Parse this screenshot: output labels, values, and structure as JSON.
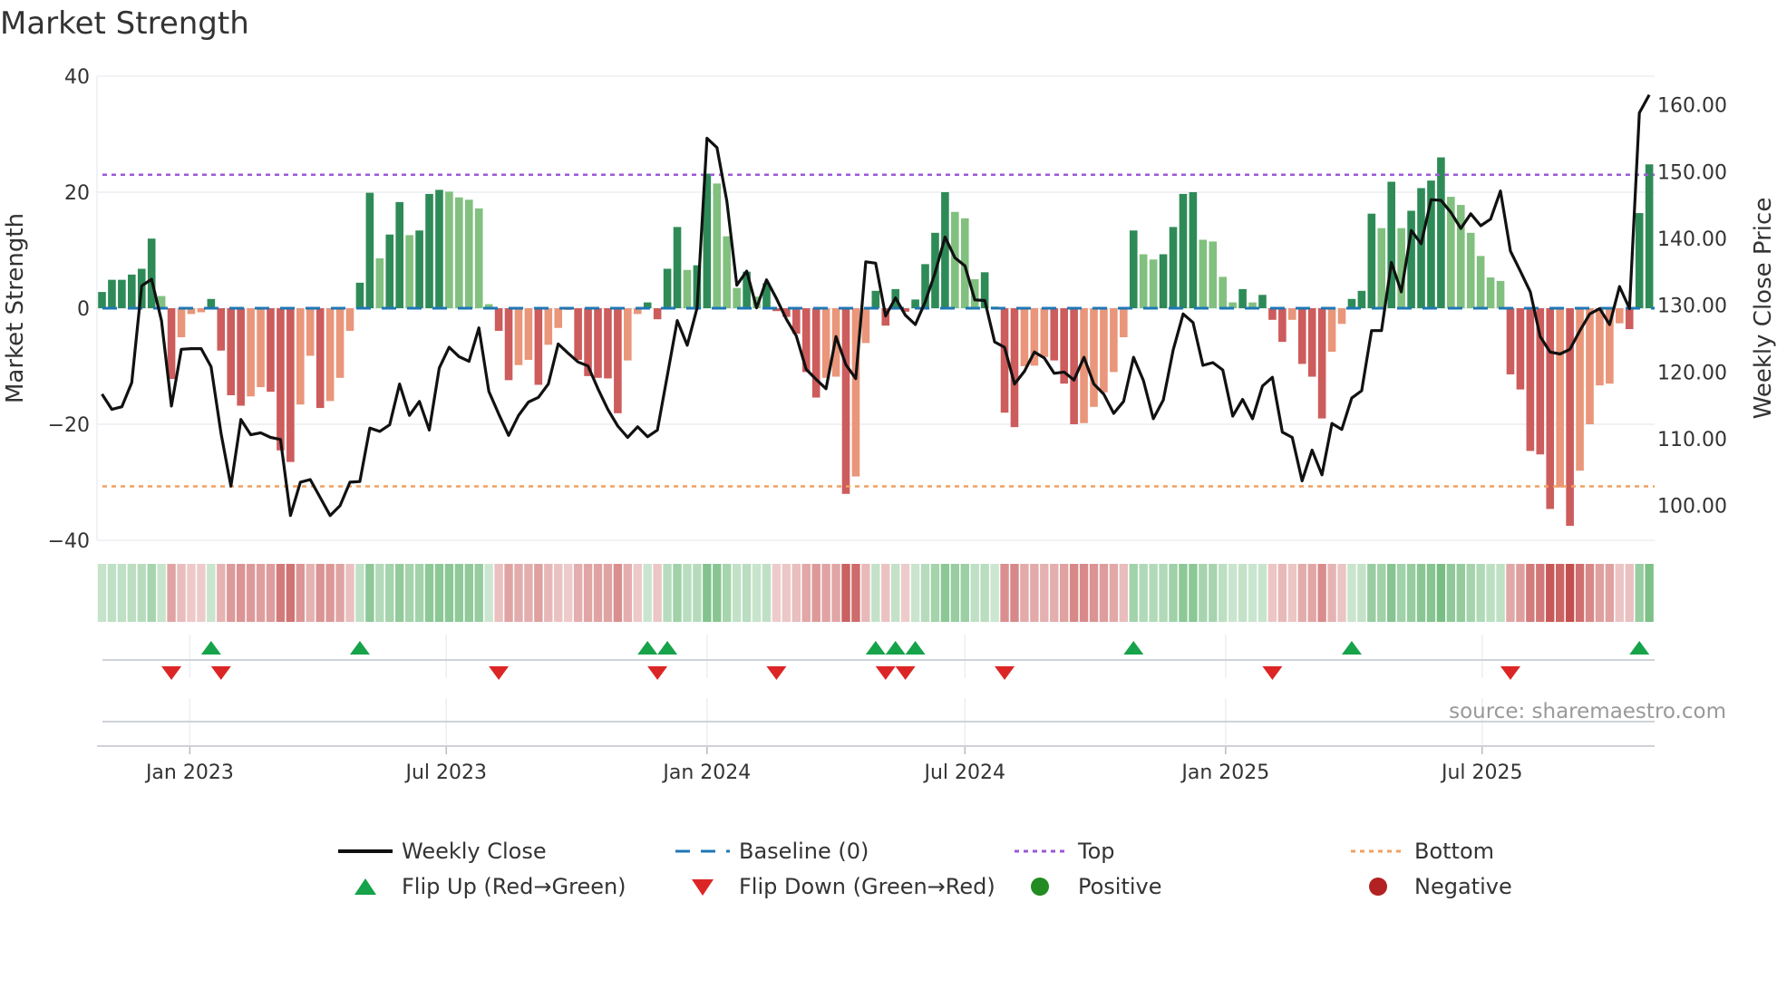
{
  "title": "Market Strength",
  "source": "source: sharemaestro.com",
  "legend": {
    "weekly_close": "Weekly Close",
    "baseline": "Baseline (0)",
    "top": "Top",
    "bottom": "Bottom",
    "flip_up": "Flip Up (Red→Green)",
    "flip_down": "Flip Down (Green→Red)",
    "positive": "Positive",
    "negative": "Negative"
  },
  "colors": {
    "strong_pos": "#2e8b57",
    "weak_pos": "#81c07f",
    "strong_neg": "#cd5c5c",
    "weak_neg": "#e9967a",
    "baseline": "#1f77b4",
    "top": "#9b59d6",
    "bottom": "#f0a060",
    "close": "#111111",
    "flip_up": "#16a34a",
    "flip_down": "#dc2626",
    "positive": "#228b22",
    "negative": "#b22222"
  },
  "chart_data": {
    "type": "bar",
    "title": "Market Strength",
    "xlabel": "",
    "ylabel": "Market Strength",
    "y2label": "Weekly Close Price",
    "ylim": [
      -40,
      40
    ],
    "y2lim": [
      94.8,
      164.3
    ],
    "yticks": [
      -40,
      -20,
      0,
      20,
      40
    ],
    "ytick_labels": [
      "−40",
      "−20",
      "0",
      "20",
      "40"
    ],
    "y2ticks": [
      100,
      110,
      120,
      130,
      140,
      150,
      160
    ],
    "y2tick_labels": [
      "100.00",
      "110.00",
      "120.00",
      "130.00",
      "140.00",
      "150.00",
      "160.00"
    ],
    "x_start": "2022-10-31",
    "x_step_days": 7,
    "xticks": [
      {
        "date": "2023-01-01",
        "label": "Jan 2023"
      },
      {
        "date": "2023-07-01",
        "label": "Jul 2023"
      },
      {
        "date": "2024-01-01",
        "label": "Jan 2024"
      },
      {
        "date": "2024-07-01",
        "label": "Jul 2024"
      },
      {
        "date": "2025-01-01",
        "label": "Jan 2025"
      },
      {
        "date": "2025-07-01",
        "label": "Jul 2025"
      }
    ],
    "top_level": 23.0,
    "bottom_level": -30.7,
    "grid": true,
    "legend_position": "bottom",
    "strength": [
      2.8,
      4.9,
      4.9,
      5.8,
      6.8,
      12,
      2.1,
      -12.2,
      -5,
      -1,
      -0.7,
      1.6,
      -7.3,
      -15,
      -16.8,
      -15.2,
      -13.6,
      -14.4,
      -24.5,
      -26.5,
      -16.6,
      -8.2,
      -17.2,
      -16,
      -12,
      -3.9,
      4.4,
      19.9,
      8.6,
      12.7,
      18.3,
      12.6,
      13.4,
      19.7,
      20.4,
      20.1,
      19.1,
      18.7,
      17.2,
      0.7,
      -3.9,
      -12.4,
      -9.8,
      -8.9,
      -13.2,
      -6.3,
      -3.4,
      -0.3,
      -8.9,
      -11.7,
      -12,
      -12.1,
      -18.1,
      -9,
      -1,
      1,
      -1.9,
      6.8,
      14,
      6.6,
      7.4,
      23.2,
      21.5,
      12.4,
      3.5,
      6.3,
      2,
      4.3,
      -0.5,
      -1.5,
      -4.4,
      -11,
      -15.4,
      -12,
      -11.8,
      -32,
      -29,
      -6,
      3,
      -3,
      3.3,
      -0.6,
      1.5,
      7.6,
      13,
      20,
      16.6,
      15.5,
      5,
      6.2,
      0.3,
      -18,
      -20.5,
      -10,
      -9.9,
      -8.4,
      -9,
      -13,
      -20,
      -19.8,
      -17,
      -14.5,
      -11,
      -5,
      13.4,
      9.3,
      8.4,
      9.3,
      14,
      19.7,
      20,
      11.8,
      11.5,
      5.4,
      1,
      3.3,
      1,
      2.3,
      -2,
      -5.8,
      -2,
      -9.6,
      -11.8,
      -19,
      -7.5,
      -2.7,
      1.6,
      3,
      16.3,
      13.8,
      21.8,
      13.8,
      16.8,
      20.7,
      22,
      26,
      19.2,
      17.8,
      13,
      9,
      5.3,
      4.7,
      -11.4,
      -14,
      -24.6,
      -25.2,
      -34.6,
      -30.9,
      -37.5,
      -28,
      -20,
      -13.3,
      -13,
      -2.6,
      -3.6,
      16.4,
      24.8
    ],
    "close": [
      116.7,
      114.4,
      114.8,
      118.4,
      132.9,
      133.9,
      127.7,
      114.9,
      123.4,
      123.5,
      123.5,
      120.8,
      110.8,
      102.9,
      112.9,
      110.6,
      110.9,
      110.2,
      109.9,
      98.5,
      103.5,
      103.9,
      101.2,
      98.5,
      100,
      103.5,
      103.6,
      111.6,
      111.1,
      112.1,
      118.2,
      113.5,
      115.6,
      111.3,
      120.6,
      123.7,
      122.3,
      121.6,
      126.6,
      117.1,
      113.7,
      110.5,
      113.5,
      115.5,
      116.2,
      118.2,
      124.2,
      122.8,
      121.5,
      120.9,
      117.5,
      114.4,
      111.9,
      110.2,
      111.8,
      110.3,
      111.3,
      119.5,
      127.7,
      124,
      129.6,
      155,
      153.6,
      145.6,
      133,
      135.1,
      129.6,
      133.8,
      131,
      127.9,
      125.4,
      120.4,
      118.9,
      117.5,
      125.3,
      121.1,
      119,
      136.5,
      136.3,
      128.4,
      131.1,
      128.5,
      127.1,
      130.5,
      134.9,
      140.2,
      137.1,
      135.9,
      130.8,
      130.7,
      124.5,
      123.7,
      118.2,
      120.1,
      123,
      122.1,
      119.8,
      120,
      118.8,
      122.2,
      118.2,
      116.7,
      113.8,
      115.6,
      122.2,
      118.7,
      113,
      115.8,
      123.3,
      128.7,
      127.4,
      121,
      121.4,
      120.3,
      113.4,
      115.9,
      113,
      117.9,
      119.2,
      111,
      110.2,
      103.7,
      108.3,
      104.6,
      112.3,
      111.4,
      116.1,
      117.2,
      126.2,
      126.2,
      136.4,
      132,
      141.2,
      139.2,
      145.8,
      145.7,
      143.9,
      141.5,
      143.7,
      141.9,
      142.9,
      147.1,
      138.1,
      135.1,
      132,
      125.3,
      123,
      122.7,
      123.4,
      126.2,
      128.7,
      129.5,
      127.1,
      132.8,
      129.5,
      158.8,
      161.5
    ]
  }
}
